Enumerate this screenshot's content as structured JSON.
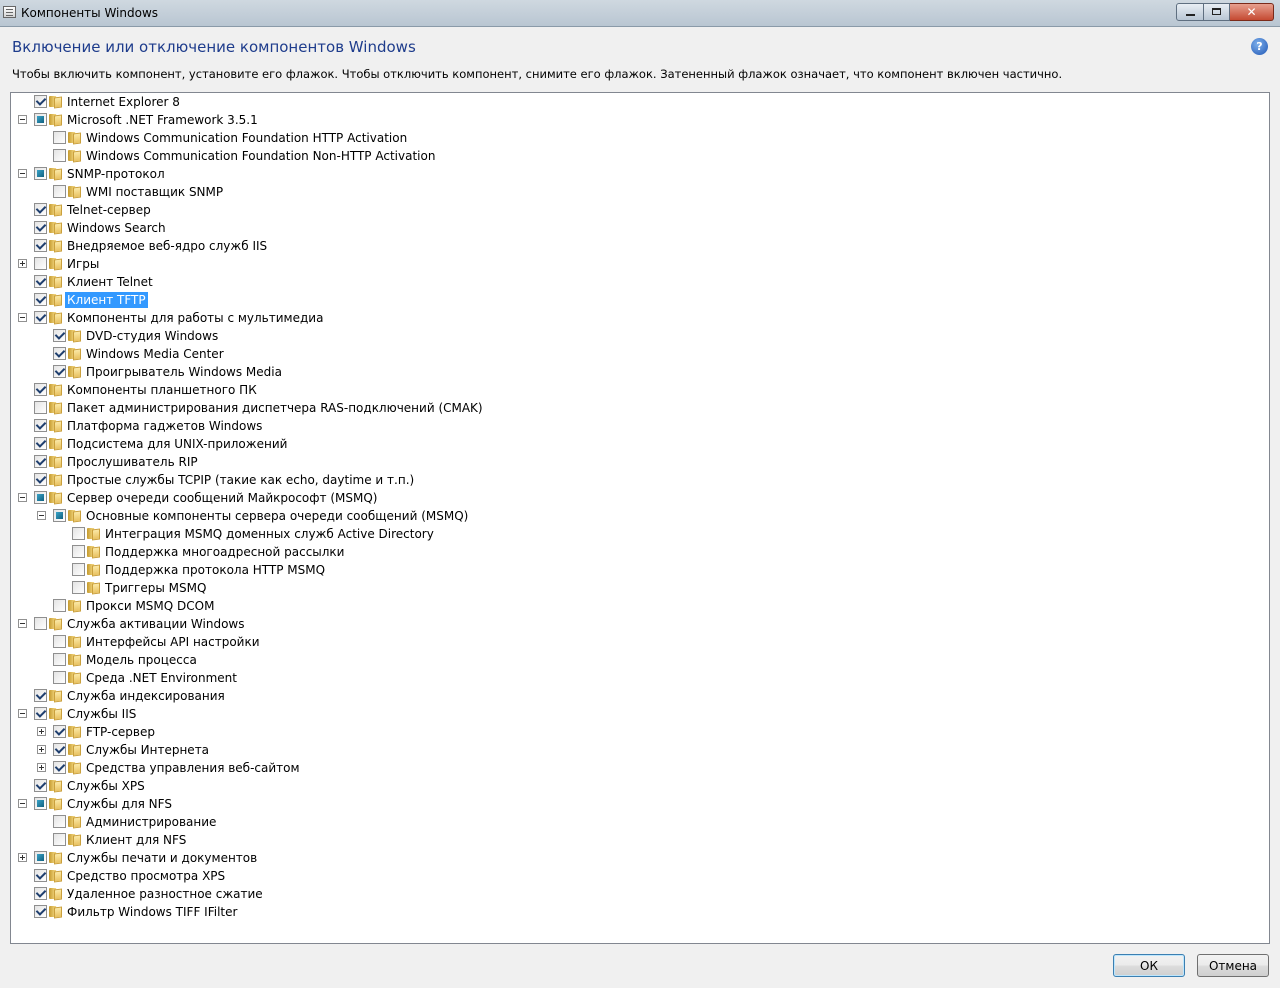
{
  "window": {
    "title": "Компоненты Windows"
  },
  "header": {
    "title": "Включение или отключение компонентов Windows",
    "description": "Чтобы включить компонент, установите его флажок. Чтобы отключить компонент, снимите его флажок. Затененный флажок означает, что компонент включен частично.",
    "help_icon": "?"
  },
  "tree": [
    {
      "label": "Internet Explorer 8",
      "level": 0,
      "state": "checked",
      "expander": "none"
    },
    {
      "label": "Microsoft .NET Framework 3.5.1",
      "level": 0,
      "state": "partial",
      "expander": "minus"
    },
    {
      "label": "Windows Communication Foundation HTTP Activation",
      "level": 1,
      "state": "unchecked",
      "expander": "none"
    },
    {
      "label": "Windows Communication Foundation Non-HTTP Activation",
      "level": 1,
      "state": "unchecked",
      "expander": "none"
    },
    {
      "label": "SNMP-протокол",
      "level": 0,
      "state": "partial",
      "expander": "minus"
    },
    {
      "label": "WMI поставщик SNMP",
      "level": 1,
      "state": "unchecked",
      "expander": "none"
    },
    {
      "label": "Telnet-сервер",
      "level": 0,
      "state": "checked",
      "expander": "none"
    },
    {
      "label": "Windows Search",
      "level": 0,
      "state": "checked",
      "expander": "none"
    },
    {
      "label": "Внедряемое веб-ядро служб IIS",
      "level": 0,
      "state": "checked",
      "expander": "none"
    },
    {
      "label": "Игры",
      "level": 0,
      "state": "unchecked",
      "expander": "plus"
    },
    {
      "label": "Клиент Telnet",
      "level": 0,
      "state": "checked",
      "expander": "none"
    },
    {
      "label": "Клиент TFTP",
      "level": 0,
      "state": "checked",
      "expander": "none",
      "selected": true
    },
    {
      "label": "Компоненты для работы с мультимедиа",
      "level": 0,
      "state": "checked",
      "expander": "minus"
    },
    {
      "label": "DVD-студия Windows",
      "level": 1,
      "state": "checked",
      "expander": "none"
    },
    {
      "label": "Windows Media Center",
      "level": 1,
      "state": "checked",
      "expander": "none"
    },
    {
      "label": "Проигрыватель Windows Media",
      "level": 1,
      "state": "checked",
      "expander": "none"
    },
    {
      "label": "Компоненты планшетного ПК",
      "level": 0,
      "state": "checked",
      "expander": "none"
    },
    {
      "label": "Пакет администрирования диспетчера RAS-подключений (CMAK)",
      "level": 0,
      "state": "unchecked",
      "expander": "none"
    },
    {
      "label": "Платформа гаджетов Windows",
      "level": 0,
      "state": "checked",
      "expander": "none"
    },
    {
      "label": "Подсистема для UNIX-приложений",
      "level": 0,
      "state": "checked",
      "expander": "none"
    },
    {
      "label": "Прослушиватель RIP",
      "level": 0,
      "state": "checked",
      "expander": "none"
    },
    {
      "label": "Простые службы TCPIP (такие как echo, daytime и т.п.)",
      "level": 0,
      "state": "checked",
      "expander": "none"
    },
    {
      "label": "Сервер очереди сообщений Майкрософт (MSMQ)",
      "level": 0,
      "state": "partial",
      "expander": "minus"
    },
    {
      "label": "Основные компоненты сервера очереди сообщений (MSMQ)",
      "level": 1,
      "state": "partial",
      "expander": "minus"
    },
    {
      "label": "Интеграция MSMQ доменных служб Active Directory",
      "level": 2,
      "state": "unchecked",
      "expander": "none"
    },
    {
      "label": "Поддержка многоадресной рассылки",
      "level": 2,
      "state": "unchecked",
      "expander": "none"
    },
    {
      "label": "Поддержка протокола HTTP MSMQ",
      "level": 2,
      "state": "unchecked",
      "expander": "none"
    },
    {
      "label": "Триггеры MSMQ",
      "level": 2,
      "state": "unchecked",
      "expander": "none"
    },
    {
      "label": "Прокси MSMQ DCOM",
      "level": 1,
      "state": "unchecked",
      "expander": "none"
    },
    {
      "label": "Служба активации Windows",
      "level": 0,
      "state": "unchecked",
      "expander": "minus"
    },
    {
      "label": "Интерфейсы API настройки",
      "level": 1,
      "state": "unchecked",
      "expander": "none"
    },
    {
      "label": "Модель процесса",
      "level": 1,
      "state": "unchecked",
      "expander": "none"
    },
    {
      "label": "Среда .NET Environment",
      "level": 1,
      "state": "unchecked",
      "expander": "none"
    },
    {
      "label": "Служба индексирования",
      "level": 0,
      "state": "checked",
      "expander": "none"
    },
    {
      "label": "Службы IIS",
      "level": 0,
      "state": "checked",
      "expander": "minus"
    },
    {
      "label": "FTP-сервер",
      "level": 1,
      "state": "checked",
      "expander": "plus"
    },
    {
      "label": "Службы Интернета",
      "level": 1,
      "state": "checked",
      "expander": "plus"
    },
    {
      "label": "Средства управления веб-сайтом",
      "level": 1,
      "state": "checked",
      "expander": "plus"
    },
    {
      "label": "Службы XPS",
      "level": 0,
      "state": "checked",
      "expander": "none"
    },
    {
      "label": "Службы для NFS",
      "level": 0,
      "state": "partial",
      "expander": "minus"
    },
    {
      "label": "Администрирование",
      "level": 1,
      "state": "unchecked",
      "expander": "none"
    },
    {
      "label": "Клиент для NFS",
      "level": 1,
      "state": "unchecked",
      "expander": "none"
    },
    {
      "label": "Службы печати и документов",
      "level": 0,
      "state": "partial",
      "expander": "plus"
    },
    {
      "label": "Средство просмотра XPS",
      "level": 0,
      "state": "checked",
      "expander": "none"
    },
    {
      "label": "Удаленное разностное сжатие",
      "level": 0,
      "state": "checked",
      "expander": "none"
    },
    {
      "label": "Фильтр Windows TIFF IFilter",
      "level": 0,
      "state": "checked",
      "expander": "none"
    }
  ],
  "buttons": {
    "ok_label": "ОК",
    "cancel_label": "Отмена"
  }
}
